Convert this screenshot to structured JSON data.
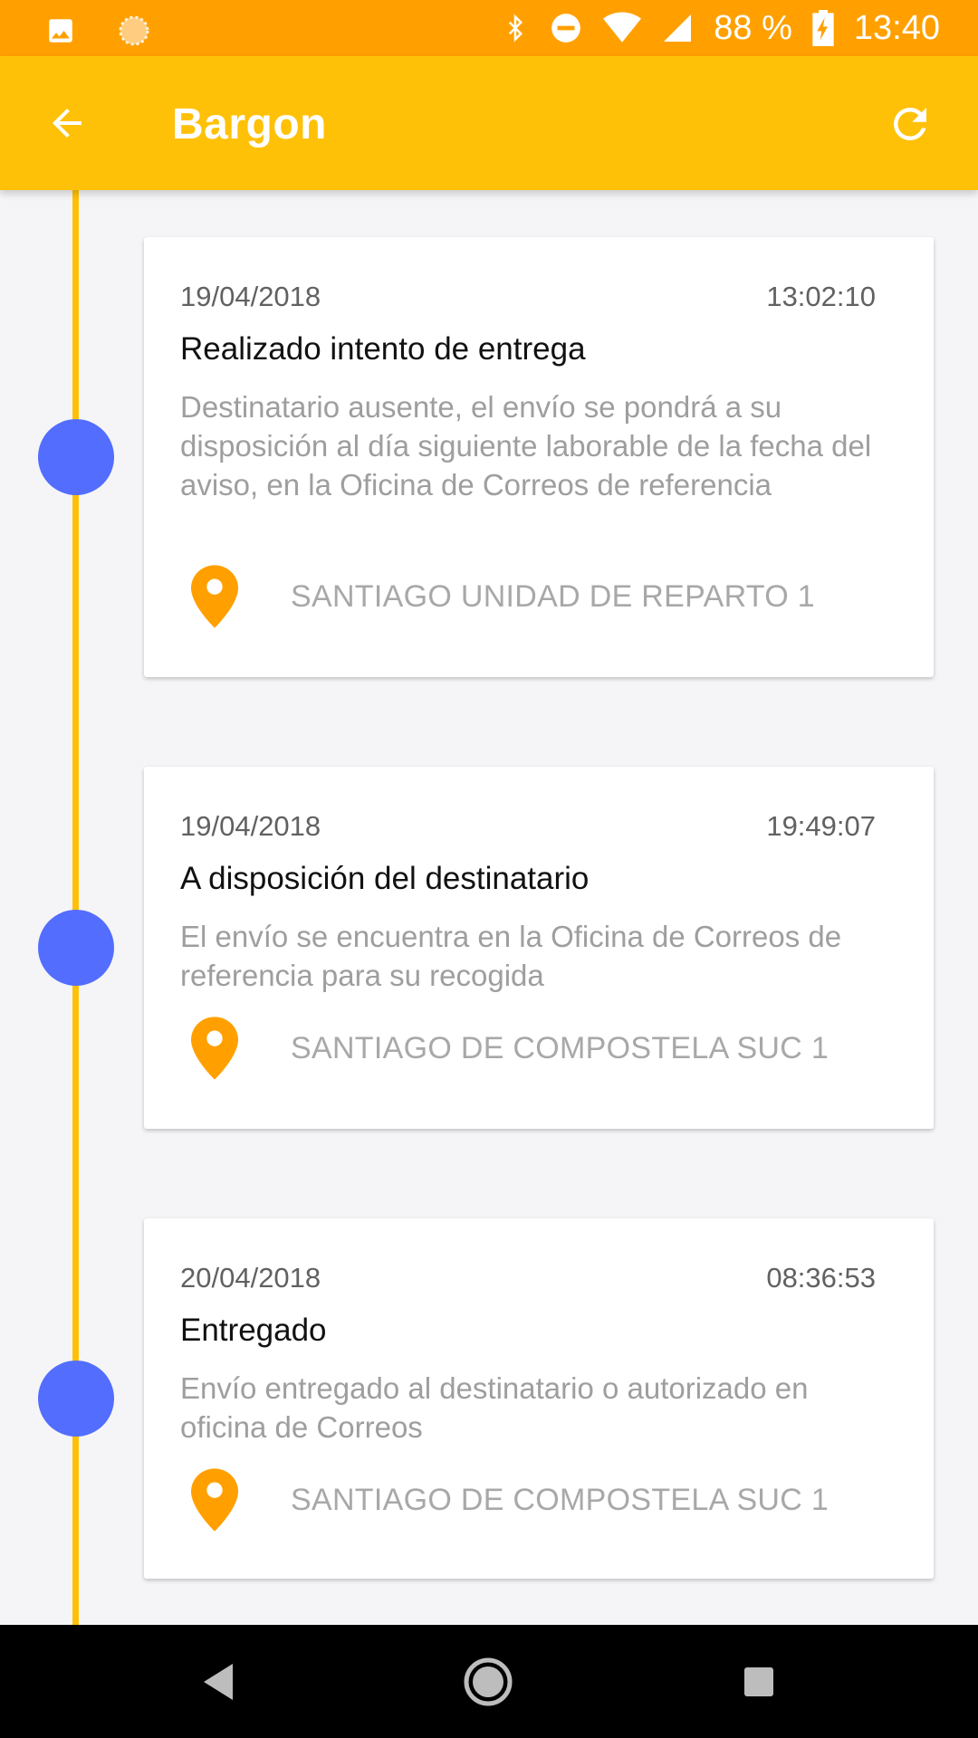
{
  "status_bar": {
    "battery": "88 %",
    "time": "13:40",
    "icons": [
      "image-icon",
      "brightness-icon",
      "bluetooth-icon",
      "do-not-disturb-icon",
      "wifi-icon",
      "signal-icon",
      "battery-charging-icon"
    ]
  },
  "app_bar": {
    "title": "Bargon",
    "back_icon": "arrow-back-icon",
    "refresh_icon": "refresh-icon"
  },
  "colors": {
    "status_bar": "#ffa000",
    "app_bar": "#ffc107",
    "timeline_line": "#ffc107",
    "timeline_dot": "#536dfe",
    "pin": "#ffa000"
  },
  "events": [
    {
      "date": "19/04/2018",
      "time": "13:02:10",
      "status": "Realizado intento de entrega",
      "description": "Destinatario ausente, el envío se pondrá a su disposición al día siguiente laborable de la fecha del aviso, en la Oficina de Correos de referencia",
      "location": "SANTIAGO UNIDAD DE REPARTO 1"
    },
    {
      "date": "19/04/2018",
      "time": "19:49:07",
      "status": "A disposición del destinatario",
      "description": "El envío se encuentra en la Oficina de Correos de referencia para su recogida",
      "location": "SANTIAGO DE COMPOSTELA SUC 1"
    },
    {
      "date": "20/04/2018",
      "time": "08:36:53",
      "status": "Entregado",
      "description": "Envío entregado al destinatario o autorizado en oficina de Correos",
      "location": "SANTIAGO DE COMPOSTELA SUC 1"
    }
  ],
  "nav_bar": {
    "icons": [
      "nav-back-icon",
      "nav-home-icon",
      "nav-recents-icon"
    ]
  }
}
